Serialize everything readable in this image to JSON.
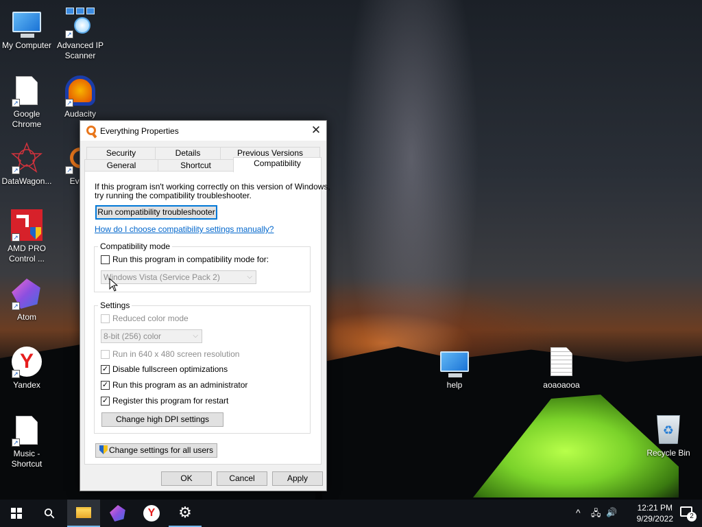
{
  "desktop": {
    "icons": [
      {
        "label": "My Computer",
        "icon": "computer-icon"
      },
      {
        "label": "Advanced IP Scanner",
        "icon": "network-scanner-icon"
      },
      {
        "label": "Google Chrome",
        "icon": "file-icon"
      },
      {
        "label": "Audacity",
        "icon": "audacity-icon"
      },
      {
        "label": "DataWagon...",
        "icon": "datawagon-icon"
      },
      {
        "label": "Every",
        "icon": "everything-icon"
      },
      {
        "label": "AMD PRO Control ...",
        "icon": "amd-icon"
      },
      {
        "label": "Atom",
        "icon": "atom-icon"
      },
      {
        "label": "Yandex",
        "icon": "yandex-icon"
      },
      {
        "label": "Music - Shortcut",
        "icon": "file-icon"
      },
      {
        "label": "help",
        "icon": "monitor-icon"
      },
      {
        "label": "aoaoaooa",
        "icon": "text-file-icon"
      },
      {
        "label": "Recycle Bin",
        "icon": "recycle-bin-icon"
      }
    ]
  },
  "dialog": {
    "title": "Everything Properties",
    "close_glyph": "✕",
    "tabs_row1": [
      "Security",
      "Details",
      "Previous Versions"
    ],
    "tabs_row2": [
      "General",
      "Shortcut",
      "Compatibility"
    ],
    "active_tab": "Compatibility",
    "intro_line1": "If this program isn't working correctly on this version of Windows,",
    "intro_line2": "try running the compatibility troubleshooter.",
    "troubleshooter_button": "Run compatibility troubleshooter",
    "help_link": "How do I choose compatibility settings manually?",
    "compat_mode": {
      "group_title": "Compatibility mode",
      "checkbox_label": "Run this program in compatibility mode for:",
      "checked": false,
      "os_select_value": "Windows Vista (Service Pack 2)"
    },
    "settings": {
      "group_title": "Settings",
      "reduced_color_label": "Reduced color mode",
      "reduced_color_checked": false,
      "color_select_value": "8-bit (256) color",
      "resolution_label": "Run in 640 x 480 screen resolution",
      "resolution_checked": false,
      "fullscreen_label": "Disable fullscreen optimizations",
      "fullscreen_checked": true,
      "admin_label": "Run this program as an administrator",
      "admin_checked": true,
      "restart_label": "Register this program for restart",
      "restart_checked": true,
      "dpi_button": "Change high DPI settings"
    },
    "all_users_button": "Change settings for all users",
    "check_glyph": "✓",
    "buttons": {
      "ok": "OK",
      "cancel": "Cancel",
      "apply": "Apply"
    }
  },
  "taskbar": {
    "search_glyph": "⚲",
    "yandex_glyph": "Y",
    "settings_glyph": "⚙",
    "tray_chevron": "^",
    "network_glyph": "🖧",
    "volume_glyph": "🔊",
    "time": "12:21 PM",
    "date": "9/29/2022",
    "notification_count": "2"
  }
}
